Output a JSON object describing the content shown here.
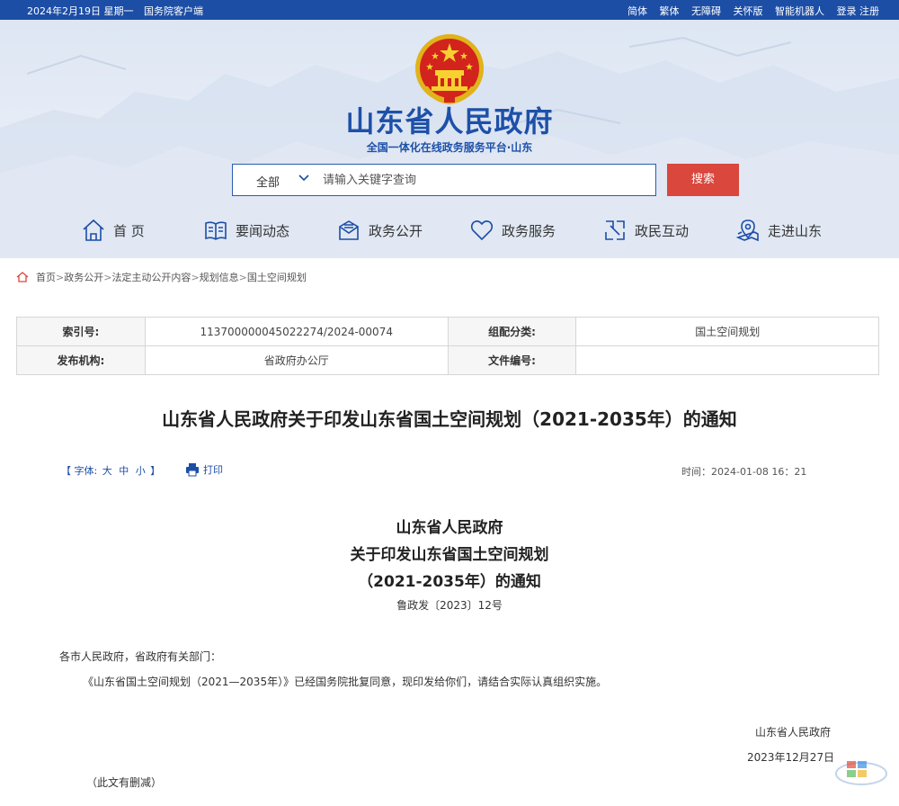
{
  "topbar": {
    "date": "2024年2月19日 星期一",
    "client": "国务院客户端",
    "links": [
      "简体",
      "繁体",
      "无障碍",
      "关怀版",
      "智能机器人",
      "登录 注册"
    ]
  },
  "header": {
    "title": "山东省人民政府",
    "subtitle": "全国一体化在线政务服务平台·山东",
    "search": {
      "scope": "全部",
      "placeholder": "请输入关键字查询",
      "button": "搜索"
    },
    "nav": [
      {
        "label": "首 页",
        "icon": "home-icon"
      },
      {
        "label": "要闻动态",
        "icon": "book-icon"
      },
      {
        "label": "政务公开",
        "icon": "mailbox-icon"
      },
      {
        "label": "政务服务",
        "icon": "heart-icon"
      },
      {
        "label": "政民互动",
        "icon": "interaction-icon"
      },
      {
        "label": "走进山东",
        "icon": "map-pin-icon"
      }
    ]
  },
  "breadcrumb": [
    "首页",
    "政务公开",
    "法定主动公开内容",
    "规划信息",
    "国土空间规划"
  ],
  "info": {
    "index_label": "索引号:",
    "index_value": "113700000045022274/2024-00074",
    "category_label": "组配分类:",
    "category_value": "国土空间规划",
    "issuer_label": "发布机构:",
    "issuer_value": "省政府办公厅",
    "docnum_label": "文件编号:",
    "docnum_value": ""
  },
  "doc_title": "山东省人民政府关于印发山东省国土空间规划（2021-2035年）的通知",
  "tools": {
    "font_prefix": "【 字体:",
    "sizes": [
      "大",
      "中",
      "小"
    ],
    "font_suffix": "】",
    "print": "打印",
    "time": "时间：2024-01-08 16：21"
  },
  "body": {
    "heading1": "山东省人民政府",
    "heading2": "关于印发山东省国土空间规划",
    "heading3": "（2021-2035年）的通知",
    "doc_no": "鲁政发〔2023〕12号",
    "salutation": "各市人民政府，省政府有关部门：",
    "paragraph": "《山东省国土空间规划（2021—2035年）》已经国务院批复同意，现印发给你们，请结合实际认真组织实施。",
    "signature": "山东省人民政府",
    "date": "2023年12月27日",
    "note": "（此文有删减）"
  },
  "colors": {
    "brand_blue": "#1c4ea6",
    "search_red": "#d9473d",
    "title_blue": "#1d50a8"
  }
}
